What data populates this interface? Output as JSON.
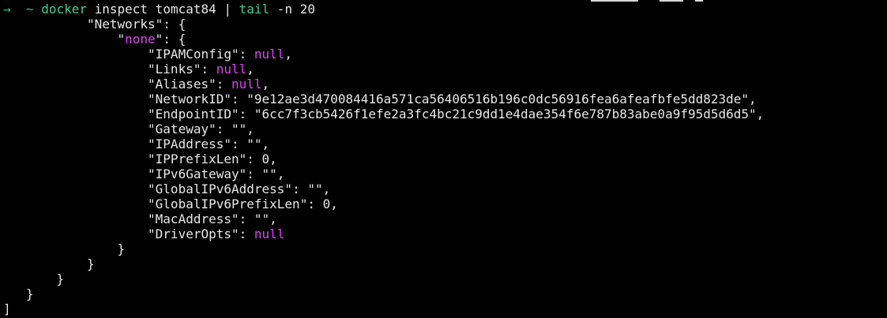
{
  "terminal": {
    "prompt": {
      "arrow": "→",
      "cwd": "~",
      "command": "docker",
      "args_before_pipe": " inspect tomcat84 | ",
      "pipe_command": "tail",
      "args_after_pipe": " -n 20"
    },
    "output": [
      {
        "indent": "           ",
        "key": "\"Networks\"",
        "sep": ": ",
        "value": "{",
        "kind": "brace"
      },
      {
        "indent": "               ",
        "key_pre": "\"",
        "key_name": "none",
        "key_post": "\"",
        "sep": ": ",
        "value": "{",
        "kind": "netname"
      },
      {
        "indent": "                   ",
        "key": "\"IPAMConfig\"",
        "sep": ": ",
        "value": "null",
        "suffix": ",",
        "kind": "null"
      },
      {
        "indent": "                   ",
        "key": "\"Links\"",
        "sep": ": ",
        "value": "null",
        "suffix": ",",
        "kind": "null"
      },
      {
        "indent": "                   ",
        "key": "\"Aliases\"",
        "sep": ": ",
        "value": "null",
        "suffix": ",",
        "kind": "null"
      },
      {
        "indent": "                   ",
        "key": "\"NetworkID\"",
        "sep": ": ",
        "value": "\"9e12ae3d470084416a571ca56406516b196c0dc56916fea6afeafbfe5dd823de\"",
        "suffix": ",",
        "kind": "plain"
      },
      {
        "indent": "                   ",
        "key": "\"EndpointID\"",
        "sep": ": ",
        "value": "\"6cc7f3cb5426f1efe2a3fc4bc21c9dd1e4dae354f6e787b83abe0a9f95d5d6d5\"",
        "suffix": ",",
        "kind": "plain"
      },
      {
        "indent": "                   ",
        "key": "\"Gateway\"",
        "sep": ": ",
        "value": "\"\"",
        "suffix": ",",
        "kind": "plain"
      },
      {
        "indent": "                   ",
        "key": "\"IPAddress\"",
        "sep": ": ",
        "value": "\"\"",
        "suffix": ",",
        "kind": "plain"
      },
      {
        "indent": "                   ",
        "key": "\"IPPrefixLen\"",
        "sep": ": ",
        "value": "0",
        "suffix": ",",
        "kind": "plain"
      },
      {
        "indent": "                   ",
        "key": "\"IPv6Gateway\"",
        "sep": ": ",
        "value": "\"\"",
        "suffix": ",",
        "kind": "plain"
      },
      {
        "indent": "                   ",
        "key": "\"GlobalIPv6Address\"",
        "sep": ": ",
        "value": "\"\"",
        "suffix": ",",
        "kind": "plain"
      },
      {
        "indent": "                   ",
        "key": "\"GlobalIPv6PrefixLen\"",
        "sep": ": ",
        "value": "0",
        "suffix": ",",
        "kind": "plain"
      },
      {
        "indent": "                   ",
        "key": "\"MacAddress\"",
        "sep": ": ",
        "value": "\"\"",
        "suffix": ",",
        "kind": "plain"
      },
      {
        "indent": "                   ",
        "key": "\"DriverOpts\"",
        "sep": ": ",
        "value": "null",
        "kind": "null"
      },
      {
        "indent": "               ",
        "text": "}",
        "kind": "text"
      },
      {
        "indent": "           ",
        "text": "}",
        "kind": "text"
      },
      {
        "indent": "       ",
        "text": "}",
        "kind": "text"
      },
      {
        "indent": "   ",
        "text": "}",
        "kind": "text"
      },
      {
        "indent": "",
        "text": "]",
        "kind": "text"
      }
    ]
  },
  "colors": {
    "background": "#000000",
    "foreground": "#e8e8e8",
    "prompt_green": "#2ec27e",
    "command_green": "#3ecf8e",
    "null_magenta": "#e040fb"
  }
}
